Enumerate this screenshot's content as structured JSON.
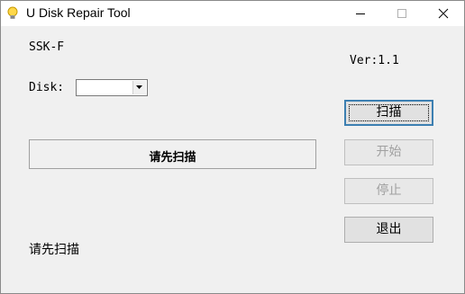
{
  "window": {
    "title": "U Disk Repair Tool"
  },
  "device": {
    "name": "SSK-F"
  },
  "version": {
    "label": "Ver:1.1"
  },
  "disk": {
    "label": "Disk:",
    "selected": ""
  },
  "status": {
    "panel_text": "请先扫描",
    "bottom_text": "请先扫描"
  },
  "buttons": {
    "scan": "扫描",
    "start": "开始",
    "stop": "停止",
    "exit": "退出"
  }
}
